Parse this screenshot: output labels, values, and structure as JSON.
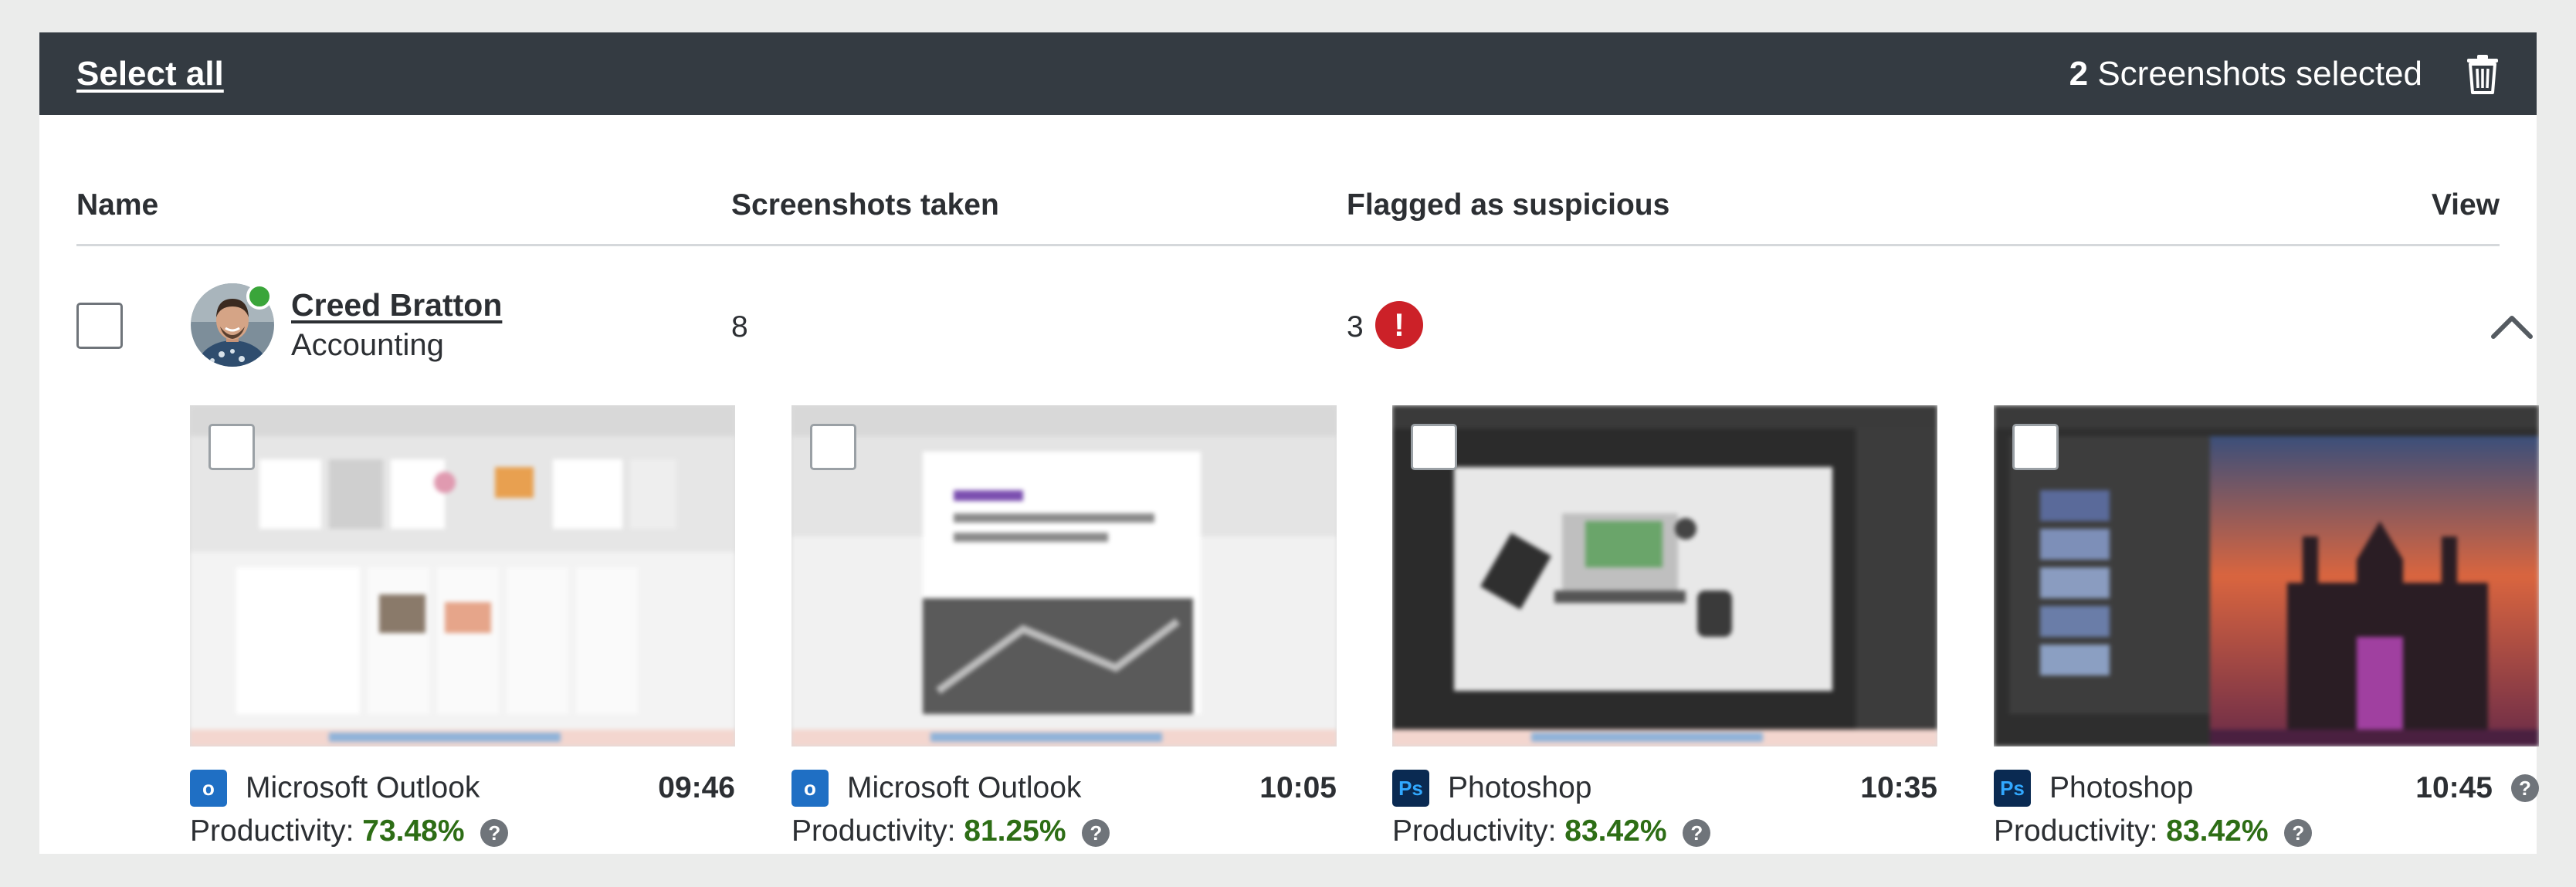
{
  "toolbar": {
    "select_all_label": "Select all",
    "selected_count": "2",
    "selected_suffix": "Screenshots selected",
    "delete_icon": "trash-icon"
  },
  "table": {
    "headers": {
      "name": "Name",
      "screenshots_taken": "Screenshots taken",
      "flagged": "Flagged as suspicious",
      "view": "View"
    }
  },
  "user": {
    "name": "Creed Bratton",
    "department": "Accounting",
    "status": "online",
    "screenshots_taken": "8",
    "flagged_count": "3",
    "flag_icon": "alert-icon",
    "expand_icon": "chevron-up-icon"
  },
  "screenshots": [
    {
      "app": "Microsoft Outlook",
      "app_icon_text": "o",
      "time": "09:46",
      "productivity_label": "Productivity:",
      "productivity": "73.48%"
    },
    {
      "app": "Microsoft Outlook",
      "app_icon_text": "o",
      "time": "10:05",
      "productivity_label": "Productivity:",
      "productivity": "81.25%"
    },
    {
      "app": "Photoshop",
      "app_icon_text": "Ps",
      "time": "10:35",
      "productivity_label": "Productivity:",
      "productivity": "83.42%"
    },
    {
      "app": "Photoshop",
      "app_icon_text": "Ps",
      "time": "10:45",
      "productivity_label": "Productivity:",
      "productivity": "83.42%"
    }
  ],
  "colors": {
    "topbar": "#343b42",
    "productivity_green": "#2d6d15",
    "flag_red": "#cc2128",
    "online_green": "#3aa53a"
  }
}
